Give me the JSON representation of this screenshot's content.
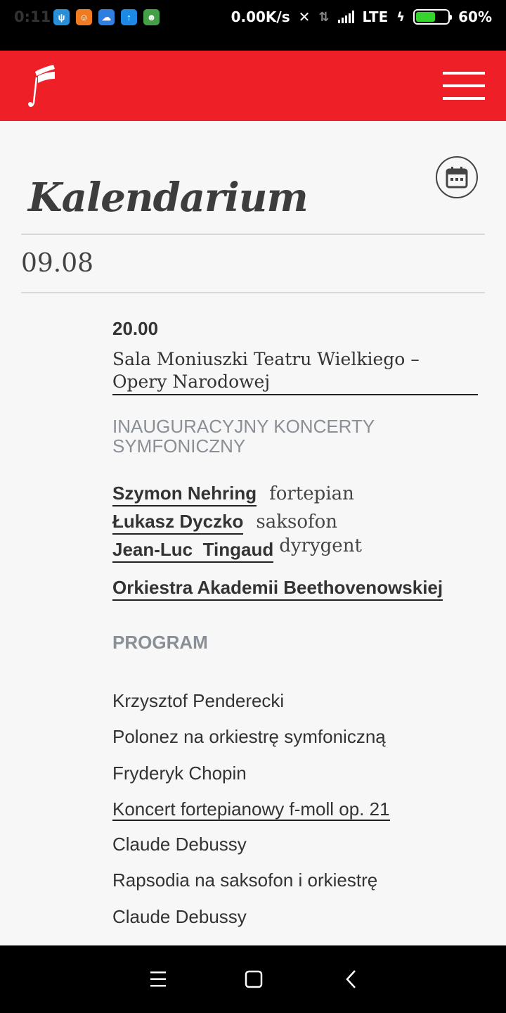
{
  "status_bar": {
    "time": "0:11",
    "net_speed": "0.00K/s",
    "network_type": "LTE",
    "battery_percent": "60%",
    "battery_level": 0.6,
    "notification_icons": [
      "vpn-icon",
      "game-icon",
      "cloud-icon",
      "upload-icon",
      "android-app-icon"
    ]
  },
  "header": {
    "logo": "festival-logo-icon",
    "menu": "hamburger-menu-icon",
    "background": "#ee1f27"
  },
  "page": {
    "title": "Kalendarium",
    "calendar_button": "calendar-icon",
    "date": "09.08"
  },
  "event": {
    "time": "20.00",
    "venue": "Sala Moniuszki Teatru Wielkiego – Opery Narodowej",
    "title": "INAUGURACYJNY KONCERTY SYMFONICZNY",
    "performers": [
      {
        "name": "Szymon Nehring",
        "role": "fortepian"
      },
      {
        "name": "Łukasz Dyczko",
        "role": "saksofon"
      },
      {
        "name": "Jean-Luc  Tingaud",
        "role": "dyrygent"
      }
    ],
    "orchestra": "Orkiestra Akademii Beethovenowskiej",
    "program_heading": "PROGRAM",
    "program": [
      {
        "composer": "Krzysztof Penderecki",
        "work": "Polonez na orkiestrę symfoniczną",
        "work_is_link": false
      },
      {
        "composer": "Fryderyk Chopin",
        "work": "Koncert fortepianowy f-moll op. 21",
        "work_is_link": true
      },
      {
        "composer": "Claude Debussy",
        "work": "Rapsodia na saksofon i orkiestrę",
        "work_is_link": false
      },
      {
        "composer": "Claude Debussy",
        "work": "",
        "work_is_link": false
      }
    ]
  },
  "nav_bar": {
    "buttons": [
      "menu-icon",
      "home-icon",
      "back-icon"
    ]
  }
}
